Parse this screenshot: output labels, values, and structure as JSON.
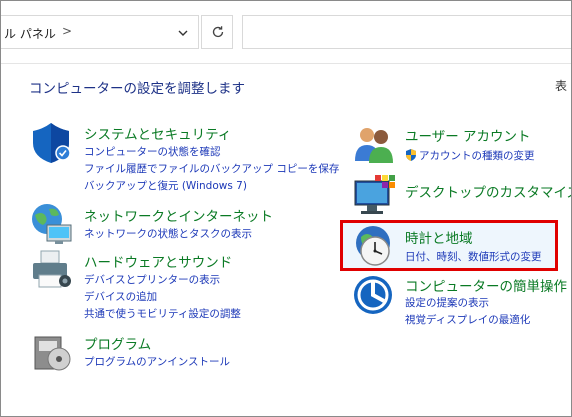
{
  "address": {
    "breadcrumb": "ル パネル",
    "separator": ">"
  },
  "header": {
    "title": "コンピューターの設定を調整します",
    "view_by": "表"
  },
  "categories_left": [
    {
      "title": "システムとセキュリティ",
      "links": [
        "コンピューターの状態を確認",
        "ファイル履歴でファイルのバックアップ コピーを保存",
        "バックアップと復元 (Windows 7)"
      ]
    },
    {
      "title": "ネットワークとインターネット",
      "links": [
        "ネットワークの状態とタスクの表示"
      ]
    },
    {
      "title": "ハードウェアとサウンド",
      "links": [
        "デバイスとプリンターの表示",
        "デバイスの追加",
        "共通で使うモビリティ設定の調整"
      ]
    },
    {
      "title": "プログラム",
      "links": [
        "プログラムのアンインストール"
      ]
    }
  ],
  "categories_right": [
    {
      "title": "ユーザー アカウント",
      "links": [
        "アカウントの種類の変更"
      ]
    },
    {
      "title": "デスクトップのカスタマイズ",
      "links": []
    },
    {
      "title": "時計と地域",
      "links": [
        "日付、時刻、数値形式の変更"
      ]
    },
    {
      "title": "コンピューターの簡単操作",
      "links": [
        "設定の提案の表示",
        "視覚ディスプレイの最適化"
      ]
    }
  ],
  "colors": {
    "title_green": "#0a7a24",
    "link_blue": "#1d39b8",
    "heading_blue": "#1e3287",
    "highlight_red": "#e00000"
  },
  "icons": [
    "shield-icon",
    "network-globe-icon",
    "printer-icon",
    "programs-disc-icon",
    "users-icon",
    "desktop-icon",
    "clock-globe-icon",
    "accessibility-icon",
    "uac-shield-icon",
    "refresh-icon",
    "chevron-down-icon"
  ]
}
